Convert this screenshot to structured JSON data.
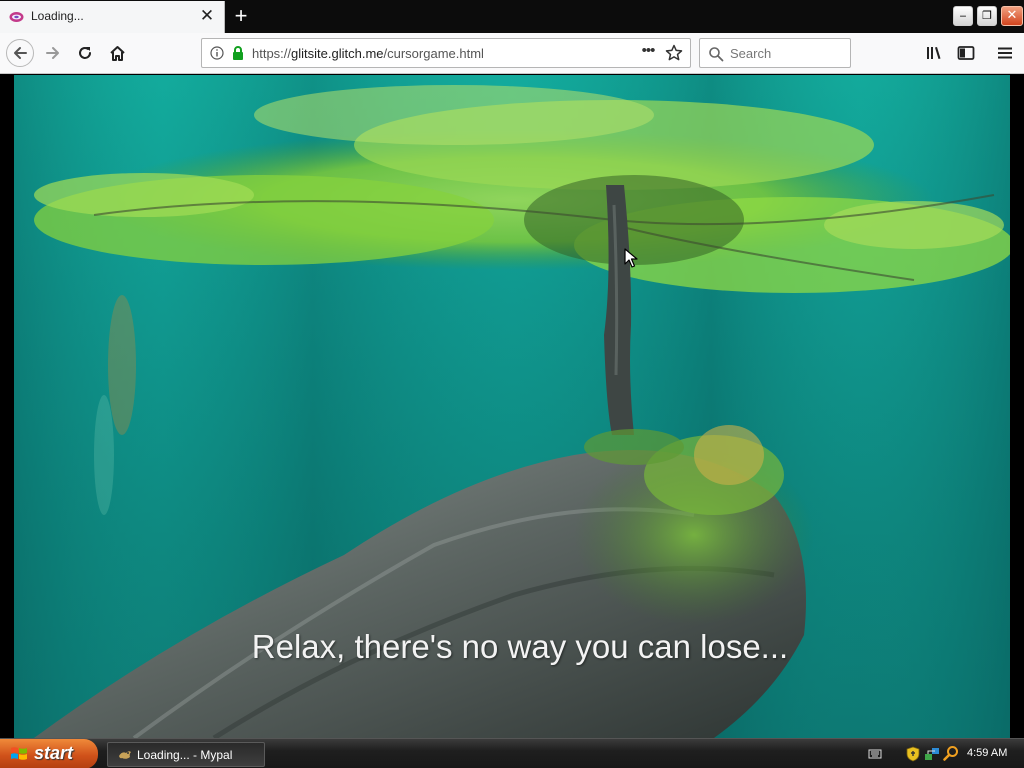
{
  "browser": {
    "tab": {
      "title": "Loading...",
      "favicon": "mypal-favicon",
      "close_label": "✕"
    },
    "new_tab_label": "+",
    "window_controls": {
      "minimize": "‒",
      "maximize": "❐",
      "close": "✕"
    },
    "nav": {
      "back_icon": "back-arrow-icon",
      "forward_icon": "forward-arrow-icon",
      "reload_icon": "reload-icon",
      "home_icon": "home-icon"
    },
    "url": {
      "scheme": "https://",
      "host": "glitsite.glitch.me",
      "path": "/cursorgame.html"
    },
    "page_actions_label": "•••",
    "search": {
      "placeholder": "Search",
      "value": ""
    }
  },
  "content": {
    "caption": "Relax, there's no way you can lose...",
    "background": "tree-on-log-over-turquoise-water"
  },
  "taskbar": {
    "start_label": "start",
    "task_button_label": "Loading... - Mypal",
    "clock": "4:59 AM"
  },
  "colors": {
    "water": "#0f8f86",
    "foliage": "#7ccf3a",
    "start_button": "#d0521a",
    "taskbar": "#1f1f1f"
  }
}
